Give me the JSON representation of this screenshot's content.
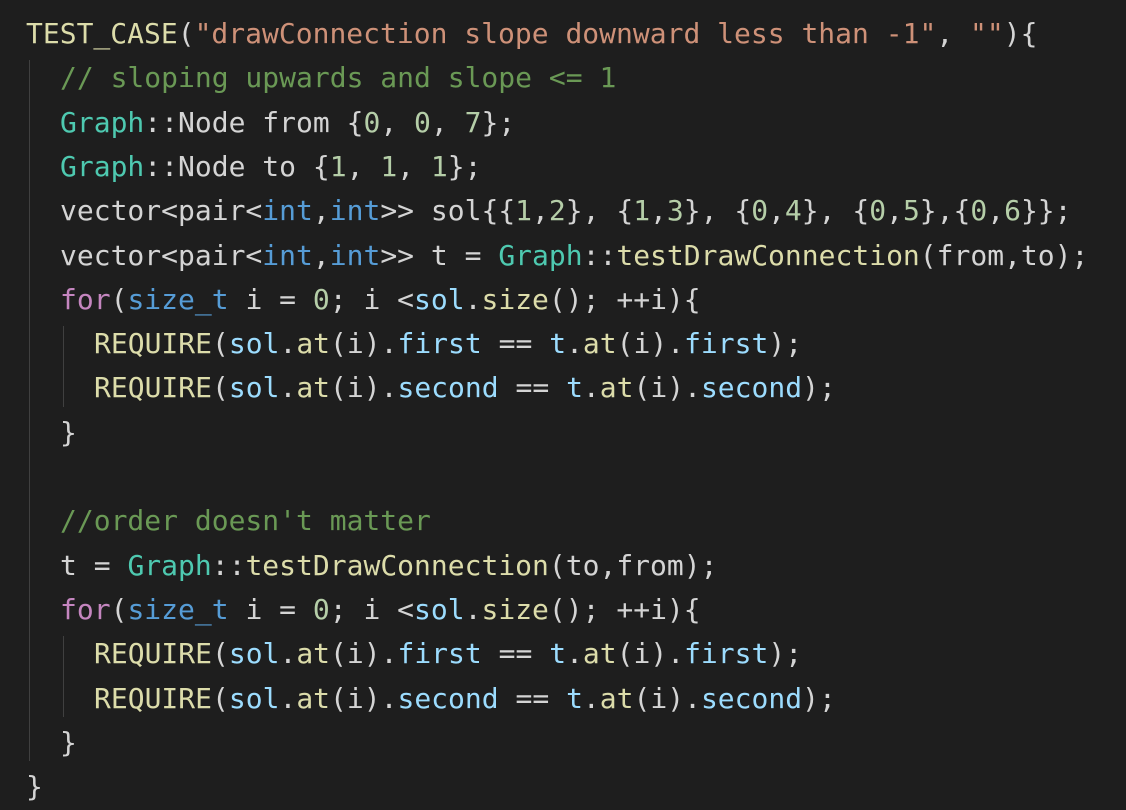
{
  "colors": {
    "background": "#1e1e1e",
    "plain": "#d4d4d4",
    "function": "#dcdcaa",
    "string": "#ce9178",
    "comment": "#6a9955",
    "type": "#4ec9b0",
    "keyword": "#569cd6",
    "control": "#c586c0",
    "number": "#b5cea8",
    "variable": "#9cdcfe"
  },
  "code_lines": [
    {
      "indent": 0,
      "tokens": [
        {
          "t": "TEST_CASE",
          "c": "func"
        },
        {
          "t": "(",
          "c": "plain"
        },
        {
          "t": "\"drawConnection slope downward less than -1\"",
          "c": "string"
        },
        {
          "t": ", ",
          "c": "plain"
        },
        {
          "t": "\"\"",
          "c": "string"
        },
        {
          "t": "){",
          "c": "plain"
        }
      ]
    },
    {
      "indent": 1,
      "tokens": [
        {
          "t": "// sloping upwards and slope <= 1",
          "c": "comment"
        }
      ]
    },
    {
      "indent": 1,
      "tokens": [
        {
          "t": "Graph",
          "c": "type"
        },
        {
          "t": "::Node from {",
          "c": "plain"
        },
        {
          "t": "0",
          "c": "number"
        },
        {
          "t": ", ",
          "c": "plain"
        },
        {
          "t": "0",
          "c": "number"
        },
        {
          "t": ", ",
          "c": "plain"
        },
        {
          "t": "7",
          "c": "number"
        },
        {
          "t": "};",
          "c": "plain"
        }
      ]
    },
    {
      "indent": 1,
      "tokens": [
        {
          "t": "Graph",
          "c": "type"
        },
        {
          "t": "::Node to {",
          "c": "plain"
        },
        {
          "t": "1",
          "c": "number"
        },
        {
          "t": ", ",
          "c": "plain"
        },
        {
          "t": "1",
          "c": "number"
        },
        {
          "t": ", ",
          "c": "plain"
        },
        {
          "t": "1",
          "c": "number"
        },
        {
          "t": "};",
          "c": "plain"
        }
      ]
    },
    {
      "indent": 1,
      "tokens": [
        {
          "t": "vector<pair<",
          "c": "plain"
        },
        {
          "t": "int",
          "c": "keyword"
        },
        {
          "t": ",",
          "c": "plain"
        },
        {
          "t": "int",
          "c": "keyword"
        },
        {
          "t": ">> sol{{",
          "c": "plain"
        },
        {
          "t": "1",
          "c": "number"
        },
        {
          "t": ",",
          "c": "plain"
        },
        {
          "t": "2",
          "c": "number"
        },
        {
          "t": "}, {",
          "c": "plain"
        },
        {
          "t": "1",
          "c": "number"
        },
        {
          "t": ",",
          "c": "plain"
        },
        {
          "t": "3",
          "c": "number"
        },
        {
          "t": "}, {",
          "c": "plain"
        },
        {
          "t": "0",
          "c": "number"
        },
        {
          "t": ",",
          "c": "plain"
        },
        {
          "t": "4",
          "c": "number"
        },
        {
          "t": "}, {",
          "c": "plain"
        },
        {
          "t": "0",
          "c": "number"
        },
        {
          "t": ",",
          "c": "plain"
        },
        {
          "t": "5",
          "c": "number"
        },
        {
          "t": "},{",
          "c": "plain"
        },
        {
          "t": "0",
          "c": "number"
        },
        {
          "t": ",",
          "c": "plain"
        },
        {
          "t": "6",
          "c": "number"
        },
        {
          "t": "}};",
          "c": "plain"
        }
      ]
    },
    {
      "indent": 1,
      "tokens": [
        {
          "t": "vector<pair<",
          "c": "plain"
        },
        {
          "t": "int",
          "c": "keyword"
        },
        {
          "t": ",",
          "c": "plain"
        },
        {
          "t": "int",
          "c": "keyword"
        },
        {
          "t": ">> t = ",
          "c": "plain"
        },
        {
          "t": "Graph",
          "c": "type"
        },
        {
          "t": "::",
          "c": "plain"
        },
        {
          "t": "testDrawConnection",
          "c": "func"
        },
        {
          "t": "(from,to);",
          "c": "plain"
        }
      ]
    },
    {
      "indent": 1,
      "tokens": [
        {
          "t": "for",
          "c": "control"
        },
        {
          "t": "(",
          "c": "plain"
        },
        {
          "t": "size_t",
          "c": "keyword"
        },
        {
          "t": " i = ",
          "c": "plain"
        },
        {
          "t": "0",
          "c": "number"
        },
        {
          "t": "; i <",
          "c": "plain"
        },
        {
          "t": "sol",
          "c": "var"
        },
        {
          "t": ".",
          "c": "plain"
        },
        {
          "t": "size",
          "c": "func"
        },
        {
          "t": "(); ++i){",
          "c": "plain"
        }
      ]
    },
    {
      "indent": 2,
      "tokens": [
        {
          "t": "REQUIRE",
          "c": "func"
        },
        {
          "t": "(",
          "c": "plain"
        },
        {
          "t": "sol",
          "c": "var"
        },
        {
          "t": ".",
          "c": "plain"
        },
        {
          "t": "at",
          "c": "func"
        },
        {
          "t": "(i).",
          "c": "plain"
        },
        {
          "t": "first",
          "c": "var"
        },
        {
          "t": " == ",
          "c": "plain"
        },
        {
          "t": "t",
          "c": "var"
        },
        {
          "t": ".",
          "c": "plain"
        },
        {
          "t": "at",
          "c": "func"
        },
        {
          "t": "(i).",
          "c": "plain"
        },
        {
          "t": "first",
          "c": "var"
        },
        {
          "t": ");",
          "c": "plain"
        }
      ]
    },
    {
      "indent": 2,
      "tokens": [
        {
          "t": "REQUIRE",
          "c": "func"
        },
        {
          "t": "(",
          "c": "plain"
        },
        {
          "t": "sol",
          "c": "var"
        },
        {
          "t": ".",
          "c": "plain"
        },
        {
          "t": "at",
          "c": "func"
        },
        {
          "t": "(i).",
          "c": "plain"
        },
        {
          "t": "second",
          "c": "var"
        },
        {
          "t": " == ",
          "c": "plain"
        },
        {
          "t": "t",
          "c": "var"
        },
        {
          "t": ".",
          "c": "plain"
        },
        {
          "t": "at",
          "c": "func"
        },
        {
          "t": "(i).",
          "c": "plain"
        },
        {
          "t": "second",
          "c": "var"
        },
        {
          "t": ");",
          "c": "plain"
        }
      ]
    },
    {
      "indent": 1,
      "tokens": [
        {
          "t": "}",
          "c": "plain"
        }
      ]
    },
    {
      "indent": 0,
      "tokens": []
    },
    {
      "indent": 1,
      "tokens": [
        {
          "t": "//order doesn't matter",
          "c": "comment"
        }
      ]
    },
    {
      "indent": 1,
      "tokens": [
        {
          "t": "t = ",
          "c": "plain"
        },
        {
          "t": "Graph",
          "c": "type"
        },
        {
          "t": "::",
          "c": "plain"
        },
        {
          "t": "testDrawConnection",
          "c": "func"
        },
        {
          "t": "(to,from);",
          "c": "plain"
        }
      ]
    },
    {
      "indent": 1,
      "tokens": [
        {
          "t": "for",
          "c": "control"
        },
        {
          "t": "(",
          "c": "plain"
        },
        {
          "t": "size_t",
          "c": "keyword"
        },
        {
          "t": " i = ",
          "c": "plain"
        },
        {
          "t": "0",
          "c": "number"
        },
        {
          "t": "; i <",
          "c": "plain"
        },
        {
          "t": "sol",
          "c": "var"
        },
        {
          "t": ".",
          "c": "plain"
        },
        {
          "t": "size",
          "c": "func"
        },
        {
          "t": "(); ++i){",
          "c": "plain"
        }
      ]
    },
    {
      "indent": 2,
      "tokens": [
        {
          "t": "REQUIRE",
          "c": "func"
        },
        {
          "t": "(",
          "c": "plain"
        },
        {
          "t": "sol",
          "c": "var"
        },
        {
          "t": ".",
          "c": "plain"
        },
        {
          "t": "at",
          "c": "func"
        },
        {
          "t": "(i).",
          "c": "plain"
        },
        {
          "t": "first",
          "c": "var"
        },
        {
          "t": " == ",
          "c": "plain"
        },
        {
          "t": "t",
          "c": "var"
        },
        {
          "t": ".",
          "c": "plain"
        },
        {
          "t": "at",
          "c": "func"
        },
        {
          "t": "(i).",
          "c": "plain"
        },
        {
          "t": "first",
          "c": "var"
        },
        {
          "t": ");",
          "c": "plain"
        }
      ]
    },
    {
      "indent": 2,
      "tokens": [
        {
          "t": "REQUIRE",
          "c": "func"
        },
        {
          "t": "(",
          "c": "plain"
        },
        {
          "t": "sol",
          "c": "var"
        },
        {
          "t": ".",
          "c": "plain"
        },
        {
          "t": "at",
          "c": "func"
        },
        {
          "t": "(i).",
          "c": "plain"
        },
        {
          "t": "second",
          "c": "var"
        },
        {
          "t": " == ",
          "c": "plain"
        },
        {
          "t": "t",
          "c": "var"
        },
        {
          "t": ".",
          "c": "plain"
        },
        {
          "t": "at",
          "c": "func"
        },
        {
          "t": "(i).",
          "c": "plain"
        },
        {
          "t": "second",
          "c": "var"
        },
        {
          "t": ");",
          "c": "plain"
        }
      ]
    },
    {
      "indent": 1,
      "tokens": [
        {
          "t": "}",
          "c": "plain"
        }
      ]
    },
    {
      "indent": 0,
      "tokens": [
        {
          "t": "}",
          "c": "plain"
        }
      ]
    }
  ]
}
